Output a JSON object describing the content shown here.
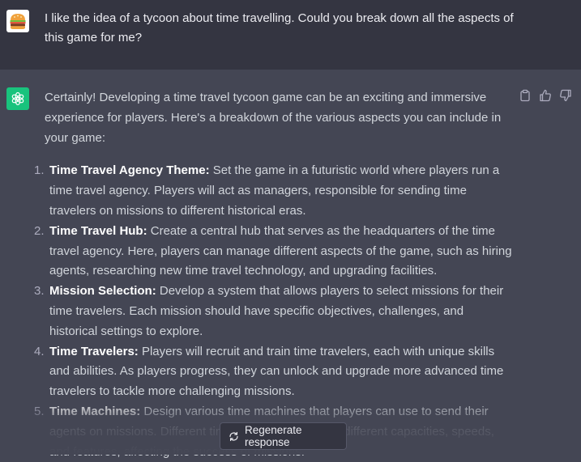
{
  "user_message": {
    "avatar": "burger-avatar-icon",
    "text": "I like the idea of a tycoon about time travelling. Could you break down all the aspects of this game for me?"
  },
  "assistant_message": {
    "avatar": "openai-logo-icon",
    "intro": "Certainly! Developing a time travel tycoon game can be an exciting and immersive experience for players. Here's a breakdown of the various aspects you can include in your game:",
    "items": [
      {
        "number": "1.",
        "title": "Time Travel Agency Theme:",
        "text": " Set the game in a futuristic world where players run a time travel agency. Players will act as managers, responsible for sending time travelers on missions to different historical eras."
      },
      {
        "number": "2.",
        "title": "Time Travel Hub:",
        "text": " Create a central hub that serves as the headquarters of the time travel agency. Here, players can manage different aspects of the game, such as hiring agents, researching new time travel technology, and upgrading facilities."
      },
      {
        "number": "3.",
        "title": "Mission Selection:",
        "text": " Develop a system that allows players to select missions for their time travelers. Each mission should have specific objectives, challenges, and historical settings to explore."
      },
      {
        "number": "4.",
        "title": "Time Travelers:",
        "text": " Players will recruit and train time travelers, each with unique skills and abilities. As players progress, they can unlock and upgrade more advanced time travelers to tackle more challenging missions."
      },
      {
        "number": "5.",
        "title": "Time Machines:",
        "text": " Design various time machines that players can use to send their agents on missions. Different time machines can have different capacities, speeds, and features, affecting the success of missions."
      }
    ]
  },
  "actions": {
    "icons": [
      "clipboard-icon",
      "thumbs-up-icon",
      "thumbs-down-icon"
    ]
  },
  "regenerate": {
    "label": "Regenerate response",
    "icon": "refresh-icon"
  },
  "colors": {
    "user_bg": "#343541",
    "assistant_bg": "#444654",
    "openai_green": "#19c37d"
  }
}
